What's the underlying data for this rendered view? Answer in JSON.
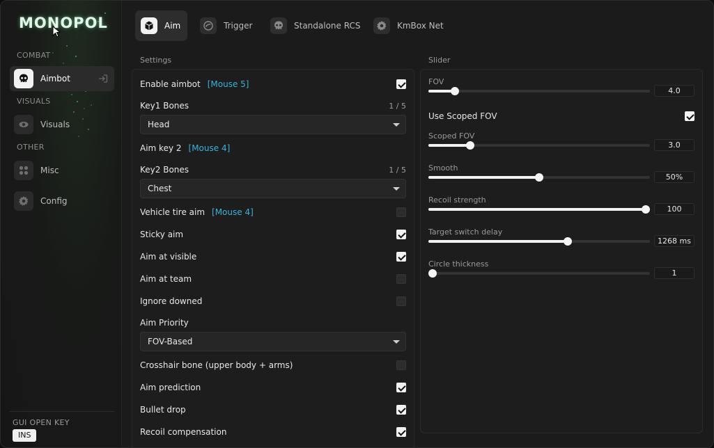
{
  "app": {
    "logo": "MONOPOL"
  },
  "sidebar": {
    "sections": [
      {
        "label": "COMBAT",
        "items": [
          {
            "label": "Aimbot",
            "icon": "skull-icon",
            "active": true
          }
        ]
      },
      {
        "label": "VISUALS",
        "items": [
          {
            "label": "Visuals",
            "icon": "eye-icon"
          }
        ]
      },
      {
        "label": "OTHER",
        "items": [
          {
            "label": "Misc",
            "icon": "grid-icon"
          },
          {
            "label": "Config",
            "icon": "gear-icon"
          }
        ]
      }
    ],
    "gui_key_label": "GUI OPEN KEY",
    "gui_key_value": "INS"
  },
  "tabs": [
    {
      "label": "Aim",
      "icon": "cube-icon",
      "active": true
    },
    {
      "label": "Trigger",
      "icon": "trigger-icon"
    },
    {
      "label": "Standalone RCS",
      "icon": "skull-icon"
    },
    {
      "label": "KmBox Net",
      "icon": "gear-icon"
    }
  ],
  "settings": {
    "title": "Settings",
    "rows": [
      {
        "label": "Enable aimbot",
        "key": "[Mouse 5]",
        "checked": true
      },
      {
        "label": "Key1 Bones",
        "count": "1 / 5"
      },
      {
        "dropdown": "Head"
      },
      {
        "label": "Aim key 2",
        "key": "[Mouse 4]"
      },
      {
        "label": "Key2 Bones",
        "count": "1 / 5"
      },
      {
        "dropdown": "Chest"
      },
      {
        "label": "Vehicle tire aim",
        "key": "[Mouse 4]",
        "checked": false
      },
      {
        "label": "Sticky aim",
        "checked": true
      },
      {
        "label": "Aim at visible",
        "checked": true
      },
      {
        "label": "Aim at team",
        "checked": false
      },
      {
        "label": "Ignore downed",
        "checked": false
      },
      {
        "label": "Aim Priority"
      },
      {
        "dropdown": "FOV-Based"
      },
      {
        "label": "Crosshair bone (upper body + arms)",
        "checked": false
      },
      {
        "label": "Aim prediction",
        "checked": true
      },
      {
        "label": "Bullet drop",
        "checked": true
      },
      {
        "label": "Recoil compensation",
        "checked": true
      }
    ]
  },
  "slider": {
    "title": "Slider",
    "items": [
      {
        "type": "slider",
        "label": "FOV",
        "value": "4.0",
        "fraction": 0.12
      },
      {
        "type": "toggle",
        "label": "Use Scoped FOV",
        "checked": true
      },
      {
        "type": "slider",
        "label": "Scoped FOV",
        "value": "3.0",
        "fraction": 0.19
      },
      {
        "type": "slider",
        "label": "Smooth",
        "value": "50%",
        "fraction": 0.5
      },
      {
        "type": "slider",
        "label": "Recoil strength",
        "value": "100",
        "fraction": 1.0
      },
      {
        "type": "slider",
        "label": "Target switch delay",
        "value": "1268 ms",
        "fraction": 0.63
      },
      {
        "type": "slider",
        "label": "Circle thickness",
        "value": "1",
        "fraction": 0.0
      }
    ]
  }
}
